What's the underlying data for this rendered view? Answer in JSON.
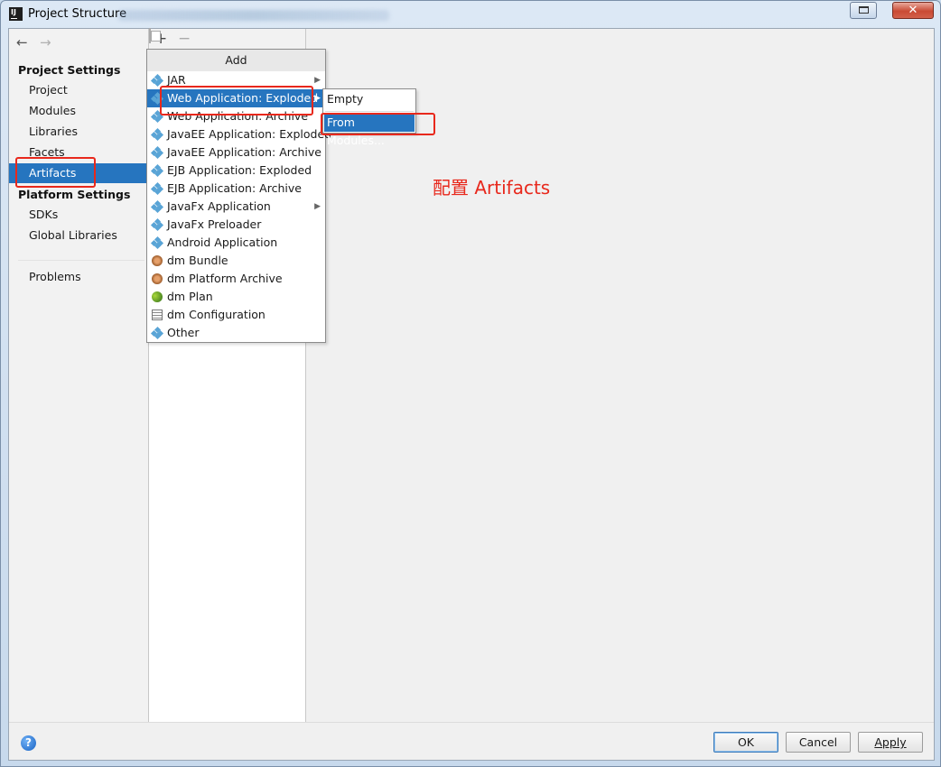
{
  "window": {
    "title": "Project Structure",
    "app_icon_text": "IJ",
    "close_glyph": "✕"
  },
  "nav": {
    "back_glyph": "←",
    "forward_glyph": "→",
    "project_settings_header": "Project Settings",
    "platform_settings_header": "Platform Settings",
    "items": {
      "project": "Project",
      "modules": "Modules",
      "libraries": "Libraries",
      "facets": "Facets",
      "artifacts": "Artifacts",
      "sdks": "SDKs",
      "global_libraries": "Global Libraries",
      "problems": "Problems"
    },
    "selected": "Artifacts"
  },
  "toolbar": {
    "add_glyph": "+",
    "remove_glyph": "−"
  },
  "popup": {
    "header": "Add",
    "items": [
      {
        "label": "JAR",
        "icon": "artifact-diamond-icon",
        "has_submenu": true
      },
      {
        "label": "Web Application: Exploded",
        "icon": "artifact-diamond-icon",
        "has_submenu": true,
        "highlighted": true
      },
      {
        "label": "Web Application: Archive",
        "icon": "artifact-diamond-icon"
      },
      {
        "label": "JavaEE Application: Exploded",
        "icon": "artifact-diamond-icon"
      },
      {
        "label": "JavaEE Application: Archive",
        "icon": "artifact-diamond-icon"
      },
      {
        "label": "EJB Application: Exploded",
        "icon": "artifact-diamond-icon"
      },
      {
        "label": "EJB Application: Archive",
        "icon": "artifact-diamond-icon"
      },
      {
        "label": "JavaFx Application",
        "icon": "artifact-diamond-icon",
        "has_submenu": true
      },
      {
        "label": "JavaFx Preloader",
        "icon": "artifact-diamond-icon"
      },
      {
        "label": "Android Application",
        "icon": "artifact-diamond-icon"
      },
      {
        "label": "dm Bundle",
        "icon": "bundle-icon"
      },
      {
        "label": "dm Platform Archive",
        "icon": "bundle-icon"
      },
      {
        "label": "dm Plan",
        "icon": "plan-icon"
      },
      {
        "label": "dm Configuration",
        "icon": "configuration-icon"
      },
      {
        "label": "Other",
        "icon": "artifact-diamond-icon"
      }
    ],
    "submenu_arrow": "▶"
  },
  "submenu": {
    "empty": "Empty",
    "from_modules": "From Modules..."
  },
  "annotation": {
    "text": "配置 Artifacts",
    "color": "#e8281c"
  },
  "buttons": {
    "help": "?",
    "ok": "OK",
    "cancel": "Cancel",
    "apply": "Apply"
  },
  "colors": {
    "selection": "#2675bf",
    "annotation": "#e8281c"
  }
}
